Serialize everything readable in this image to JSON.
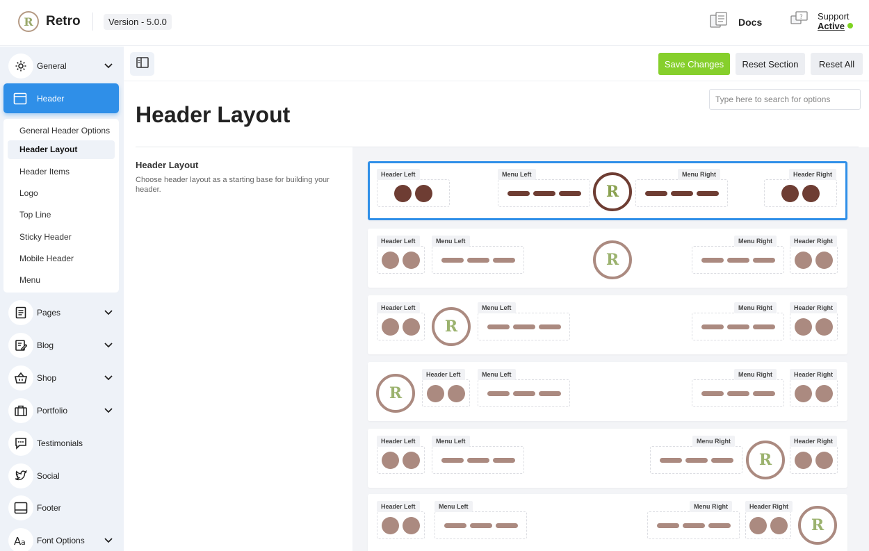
{
  "brand": {
    "name": "Retro",
    "logo_letter": "R",
    "version": "Version - 5.0.0"
  },
  "top_links": {
    "docs": "Docs",
    "support_label": "Support",
    "support_status": "Active"
  },
  "colors": {
    "accent_blue": "#2f8fe8",
    "save_green": "#86cf2c",
    "selected_brown": "#6e3d33",
    "muted_brown": "#ab8a80",
    "logo_green": "#9bb26e"
  },
  "sidebar": {
    "items": [
      {
        "label": "General",
        "icon": "gear-icon",
        "has_chevron": true
      },
      {
        "label": "Header",
        "icon": "header-layout-icon",
        "active": true
      },
      {
        "label": "Pages",
        "icon": "pages-icon",
        "has_chevron": true
      },
      {
        "label": "Blog",
        "icon": "blog-edit-icon",
        "has_chevron": true
      },
      {
        "label": "Shop",
        "icon": "basket-icon",
        "has_chevron": true
      },
      {
        "label": "Portfolio",
        "icon": "briefcase-icon",
        "has_chevron": true
      },
      {
        "label": "Testimonials",
        "icon": "chat-bubble-icon"
      },
      {
        "label": "Social",
        "icon": "twitter-icon"
      },
      {
        "label": "Footer",
        "icon": "footer-layout-icon"
      },
      {
        "label": "Font Options",
        "icon": "font-icon",
        "has_chevron": true
      }
    ],
    "header_submenu": [
      "General Header Options",
      "Header Layout",
      "Header Items",
      "Logo",
      "Top Line",
      "Sticky Header",
      "Mobile Header",
      "Menu"
    ],
    "current_submenu": "Header Layout"
  },
  "toolbar": {
    "save_label": "Save Changes",
    "reset_section_label": "Reset Section",
    "reset_all_label": "Reset All"
  },
  "search": {
    "placeholder": "Type here to search for options"
  },
  "page": {
    "title": "Header Layout"
  },
  "option": {
    "title": "Header Layout",
    "description": "Choose header layout as a starting base for building your header."
  },
  "layout_labels": {
    "header_left": "Header Left",
    "menu_left": "Menu Left",
    "menu_right": "Menu Right",
    "header_right": "Header Right"
  },
  "layouts": [
    {
      "id": 1,
      "selected": true
    },
    {
      "id": 2,
      "selected": false
    },
    {
      "id": 3,
      "selected": false
    },
    {
      "id": 4,
      "selected": false
    },
    {
      "id": 5,
      "selected": false
    },
    {
      "id": 6,
      "selected": false
    }
  ]
}
